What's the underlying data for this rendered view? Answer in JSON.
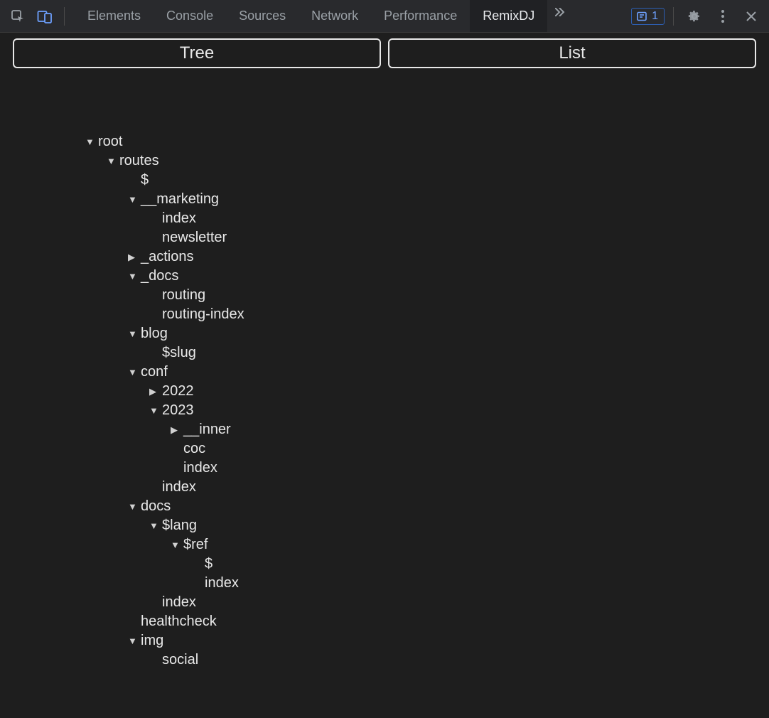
{
  "toolbar": {
    "tabs": {
      "elements": "Elements",
      "console": "Console",
      "sources": "Sources",
      "network": "Network",
      "performance": "Performance",
      "remixdj": "RemixDJ"
    },
    "active_tab": "remixdj",
    "issues_count": "1"
  },
  "view_toggle": {
    "tree": "Tree",
    "list": "List"
  },
  "tree": [
    {
      "label": "root",
      "expanded": true,
      "children": [
        {
          "label": "routes",
          "expanded": true,
          "children": [
            {
              "label": "$"
            },
            {
              "label": "__marketing",
              "expanded": true,
              "children": [
                {
                  "label": "index"
                },
                {
                  "label": "newsletter"
                }
              ]
            },
            {
              "label": "_actions",
              "expanded": false,
              "children": []
            },
            {
              "label": "_docs",
              "expanded": true,
              "children": [
                {
                  "label": "routing"
                },
                {
                  "label": "routing-index"
                }
              ]
            },
            {
              "label": "blog",
              "expanded": true,
              "children": [
                {
                  "label": "$slug"
                }
              ]
            },
            {
              "label": "conf",
              "expanded": true,
              "children": [
                {
                  "label": "2022",
                  "expanded": false,
                  "children": []
                },
                {
                  "label": "2023",
                  "expanded": true,
                  "children": [
                    {
                      "label": "__inner",
                      "expanded": false,
                      "children": []
                    },
                    {
                      "label": "coc"
                    },
                    {
                      "label": "index"
                    }
                  ]
                },
                {
                  "label": "index"
                }
              ]
            },
            {
              "label": "docs",
              "expanded": true,
              "children": [
                {
                  "label": "$lang",
                  "expanded": true,
                  "children": [
                    {
                      "label": "$ref",
                      "expanded": true,
                      "children": [
                        {
                          "label": "$"
                        },
                        {
                          "label": "index"
                        }
                      ]
                    }
                  ]
                },
                {
                  "label": "index"
                }
              ]
            },
            {
              "label": "healthcheck"
            },
            {
              "label": "img",
              "expanded": true,
              "children": [
                {
                  "label": "social"
                }
              ]
            }
          ]
        }
      ]
    }
  ]
}
